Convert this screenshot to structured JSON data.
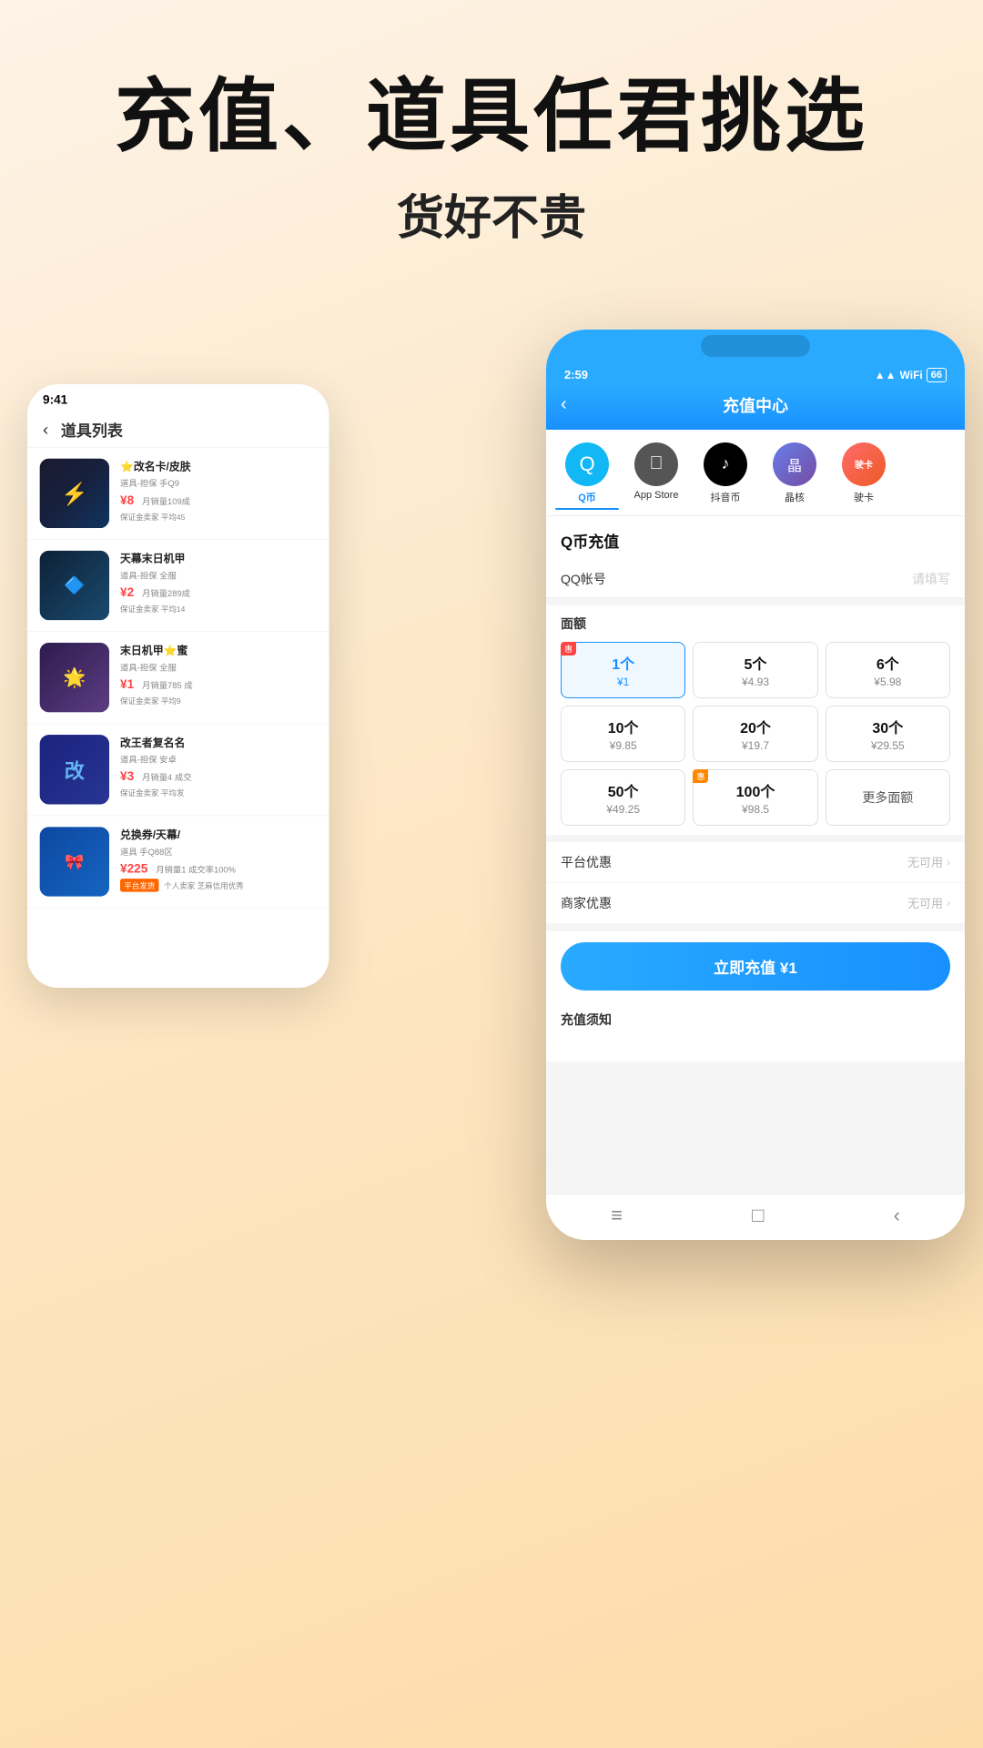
{
  "hero": {
    "title": "充值、道具任君挑选",
    "subtitle": "货好不贵"
  },
  "back_phone": {
    "status_time": "9:41",
    "nav_title": "道具列表",
    "items": [
      {
        "name": "⭐改名卡/皮肤",
        "desc": "道具-担保 手Q9",
        "price": "¥8",
        "sold": "月销量109成",
        "guarantee": "保证金卖家 平均45",
        "img_class": "img-item1",
        "img_icon": "⚡"
      },
      {
        "name": "天幕末日机甲",
        "desc": "道具-担保 全服",
        "price": "¥2",
        "sold": "月销量289成",
        "guarantee": "保证金卖家 平均14",
        "img_class": "img-item2",
        "img_icon": "🔷"
      },
      {
        "name": "末日机甲⭐蜜",
        "desc": "道具-担保 全服",
        "price": "¥1",
        "sold": "月销量785 成",
        "guarantee": "保证金卖家 平均9",
        "img_class": "img-item3",
        "img_icon": "🌟"
      },
      {
        "name": "改王者复名名",
        "desc": "道具-担保 安卓",
        "price": "¥3",
        "sold": "月销量4 成交",
        "guarantee": "保证金卖家 平均发",
        "img_class": "img-item4",
        "img_icon": "🔵"
      },
      {
        "name": "兑换券/天幕/",
        "desc": "道具 手Q88区",
        "price": "¥225",
        "sold": "月销量1 成交率100%",
        "guarantee": "平台发货 个人卖家 芝麻信用优秀",
        "badge": "平台发货",
        "img_class": "img-item5",
        "img_icon": "🎀"
      }
    ]
  },
  "front_phone": {
    "status_time": "2:59",
    "status_icons": "▲▲ WiFi 66",
    "header_title": "充值中心",
    "back_arrow": "‹",
    "tabs": [
      {
        "label": "Q币",
        "icon_type": "qq",
        "icon_text": "Q",
        "active": true
      },
      {
        "label": "App Store",
        "icon_type": "apple",
        "icon_text": "",
        "active": false
      },
      {
        "label": "抖音币",
        "icon_type": "douyin",
        "icon_text": "♪",
        "active": false
      },
      {
        "label": "晶核",
        "icon_type": "jinghe",
        "icon_text": "晶",
        "active": false
      },
      {
        "label": "驶卡",
        "icon_type": "junka",
        "icon_text": "驶卡",
        "active": false
      }
    ],
    "section_title": "Q币充值",
    "account_label": "QQ帐号",
    "account_placeholder": "请填写",
    "denomination_title": "面额",
    "denominations": [
      {
        "count": "1个",
        "price": "¥1",
        "selected": true,
        "badge": "惠"
      },
      {
        "count": "5个",
        "price": "¥4.93",
        "selected": false
      },
      {
        "count": "6个",
        "price": "¥5.98",
        "selected": false
      },
      {
        "count": "10个",
        "price": "¥9.85",
        "selected": false
      },
      {
        "count": "20个",
        "price": "¥19.7",
        "selected": false
      },
      {
        "count": "30个",
        "price": "¥29.55",
        "selected": false
      },
      {
        "count": "50个",
        "price": "¥49.25",
        "selected": false
      },
      {
        "count": "100个",
        "price": "¥98.5",
        "selected": false,
        "badge": "惠"
      },
      {
        "count": "更多面额",
        "price": "",
        "selected": false,
        "is_more": true
      }
    ],
    "discounts": [
      {
        "label": "平台优惠",
        "value": "无可用"
      },
      {
        "label": "商家优惠",
        "value": "无可用"
      }
    ],
    "cta_label": "立即充值 ¥1",
    "notice_title": "充值须知",
    "bottom_nav": [
      "≡",
      "□",
      "‹"
    ]
  }
}
